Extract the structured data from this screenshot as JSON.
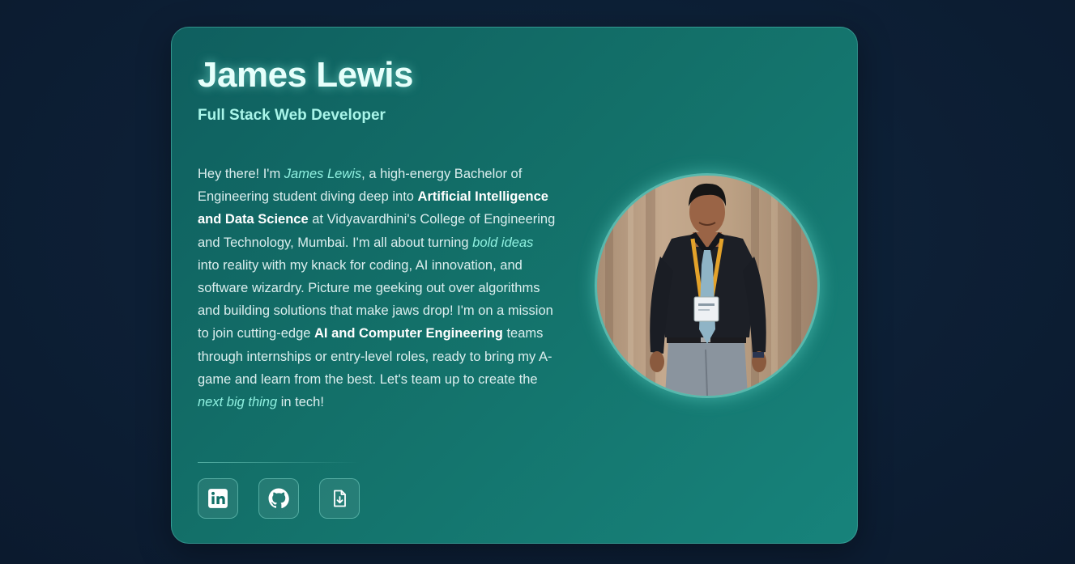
{
  "profile": {
    "name": "James Lewis",
    "title": "Full Stack Web Developer"
  },
  "bio": {
    "p1": "Hey there! I'm ",
    "em_name": "James Lewis",
    "p2": ", a high-energy Bachelor of Engineering student diving deep into ",
    "strong_field": "Artificial Intelligence and Data Science",
    "p3": " at Vidyavardhini's College of Engineering and Technology, Mumbai. I'm all about turning ",
    "em_ideas": "bold ideas",
    "p4": " into reality with my knack for coding, AI innovation, and software wizardry. Picture me geeking out over algorithms and building solutions that make jaws drop! I'm on a mission to join cutting-edge ",
    "strong_teams": "AI and Computer Engineering",
    "p5": " teams through internships or entry-level roles, ready to bring my A-game and learn from the best. Let's team up to create the ",
    "em_next": "next big thing",
    "p6": " in tech!"
  },
  "socials": [
    {
      "icon": "linkedin-icon"
    },
    {
      "icon": "github-icon"
    },
    {
      "icon": "resume-download-icon"
    }
  ],
  "colors": {
    "page_bg": "#0d1f35",
    "card_gradient_start": "#0f5f5f",
    "card_gradient_end": "#17837b",
    "name": "#e6fffb",
    "title": "#a9f5e9",
    "emphasis": "#8ff0e0"
  }
}
